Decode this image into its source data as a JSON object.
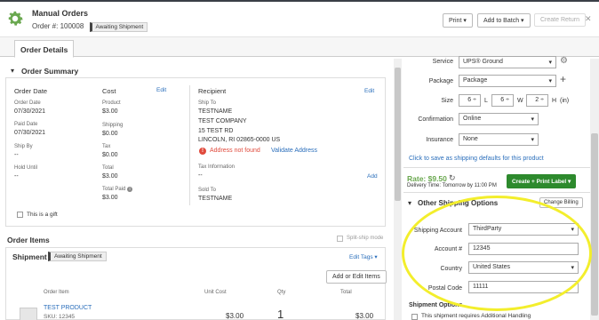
{
  "header": {
    "title": "Manual Orders",
    "order_number": "Order #: 100008",
    "status_badge": "Awaiting Shipment",
    "print_label": "Print",
    "add_to_batch_label": "Add to Batch",
    "create_return_label": "Create Return",
    "close_glyph": "✕"
  },
  "tabs": {
    "order_details": "Order Details"
  },
  "order_summary": {
    "title": "Order Summary",
    "columns": {
      "order_date": "Order Date",
      "cost": "Cost",
      "edit": "Edit",
      "recipient": "Recipient"
    },
    "order_date_label": "Order Date",
    "order_date": "07/30/2021",
    "paid_date_label": "Paid Date",
    "paid_date": "07/30/2021",
    "ship_by_label": "Ship By",
    "ship_by": "--",
    "hold_until_label": "Hold Until",
    "hold_until": "--",
    "product_label": "Product",
    "product": "$3.00",
    "shipping_label": "Shipping",
    "shipping": "$0.00",
    "tax_label": "Tax",
    "tax": "$0.00",
    "total_label": "Total",
    "total": "$3.00",
    "total_paid_label": "Total Paid",
    "total_paid": "$3.00",
    "is_gift_label": "This is a gift",
    "ship_to_label": "Ship To",
    "ship_to_name": "TESTNAME",
    "ship_to_company": "TEST COMPANY",
    "ship_to_street": "15 TEST RD",
    "ship_to_city": "LINCOLN, RI 02865-0000 US",
    "address_warning": "Address not found",
    "validate_address": "Validate Address",
    "tax_info_label": "Tax Information",
    "tax_info_value": "--",
    "add_label": "Add",
    "sold_to_label": "Sold To",
    "sold_to_name": "TESTNAME"
  },
  "order_items": {
    "title": "Order Items",
    "split_ship_mode": "Split-ship mode",
    "shipment_title": "Shipment",
    "shipment_badge": "Awaiting Shipment",
    "edit_tags": "Edit Tags",
    "add_edit_items": "Add or Edit Items",
    "columns": [
      "Order Item",
      "Unit Cost",
      "Qty",
      "Total"
    ],
    "rows": [
      {
        "name": "TEST PRODUCT",
        "sku": "SKU: 12345",
        "unit_cost": "$3.00",
        "qty": "1",
        "total": "$3.00"
      }
    ]
  },
  "shipping": {
    "service_label": "Service",
    "service_value": "UPS® Ground",
    "package_label": "Package",
    "package_value": "Package",
    "size_label": "Size",
    "size_l": "6",
    "size_w": "6",
    "size_h": "2",
    "l_label": "L",
    "w_label": "W",
    "h_label": "H",
    "in_label": "(in)",
    "confirmation_label": "Confirmation",
    "confirmation_value": "Online",
    "insurance_label": "Insurance",
    "insurance_value": "None",
    "save_defaults_link": "Click to save as shipping defaults for this product",
    "rate_label": "Rate: $9.50",
    "delivery_time": "Delivery Time: Tomorrow by 11:00 PM",
    "create_print_label": "Create + Print Label"
  },
  "other_shipping": {
    "title": "Other Shipping Options",
    "change_billing": "Change Billing",
    "shipping_account_label": "Shipping Account",
    "shipping_account_value": "ThirdParty",
    "account_num_label": "Account #",
    "account_num_value": "12345",
    "country_label": "Country",
    "country_value": "United States",
    "postal_code_label": "Postal Code",
    "postal_code_value": "11111",
    "shipment_options_label": "Shipment Options",
    "additional_handling": "This shipment requires Additional Handling"
  },
  "colors": {
    "accent_green": "#6aa84f",
    "link_blue": "#2a6ebb",
    "highlight_yellow": "#f3ee2c",
    "button_green": "#2d8a2d"
  }
}
